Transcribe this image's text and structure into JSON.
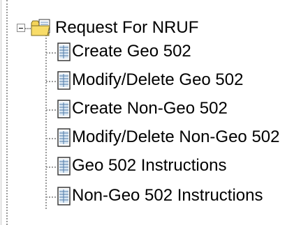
{
  "tree": {
    "root": {
      "label": "Request For NRUF",
      "icon": "folder-document-icon",
      "expanded": true
    },
    "children": [
      {
        "label": "Create Geo 502",
        "icon": "document-icon"
      },
      {
        "label": "Modify/Delete Geo 502",
        "icon": "document-icon"
      },
      {
        "label": "Create Non-Geo 502",
        "icon": "document-icon"
      },
      {
        "label": "Modify/Delete Non-Geo 502",
        "icon": "document-icon"
      },
      {
        "label": "Geo 502 Instructions",
        "icon": "document-icon"
      },
      {
        "label": "Non-Geo 502 Instructions",
        "icon": "document-icon"
      }
    ]
  },
  "colors": {
    "connector": "#9a9a9a",
    "text": "#000000",
    "folder": "#f5d45a",
    "document": "#7aa4c9"
  }
}
